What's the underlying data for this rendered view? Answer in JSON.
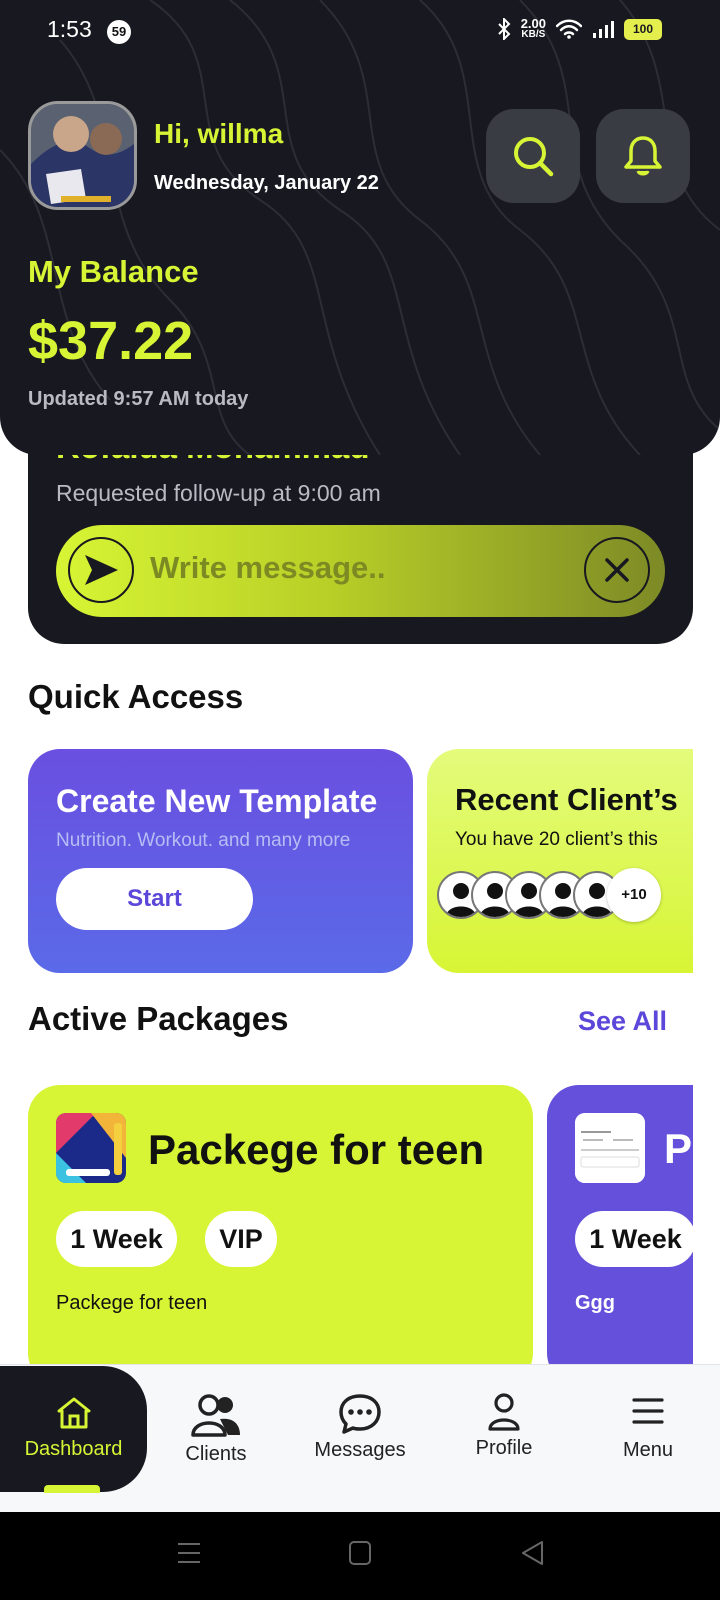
{
  "status_bar": {
    "time": "1:53",
    "notification_count": "59",
    "net_speed_value": "2.00",
    "net_speed_unit": "KB/S",
    "battery": "100"
  },
  "header": {
    "greeting": "Hi, willma",
    "date": "Wednesday, January 22",
    "balance_label": "My Balance",
    "balance_value": "$37.22",
    "updated_text": "Updated 9:57 AM today",
    "icons": [
      "search-icon",
      "bell-icon"
    ]
  },
  "message_card": {
    "client_name": "Rofaida Mohammad",
    "subtitle": "Requested follow-up at 9:00 am",
    "placeholder": "Write message..",
    "icons": [
      "send-icon",
      "close-icon"
    ]
  },
  "quick_access": {
    "title": "Quick Access",
    "create_template": {
      "title": "Create New Template",
      "subtitle": "Nutrition. Workout. and many more",
      "button": "Start"
    },
    "recent_clients": {
      "title": "Recent Client’s",
      "subtitle": "You have 20 client’s this",
      "more_count": "+10"
    }
  },
  "packages": {
    "title": "Active Packages",
    "see_all": "See All",
    "items": [
      {
        "name": "Packege for teen",
        "duration": "1 Week",
        "tier": "VIP",
        "description": "Packege for teen",
        "color": "#d7f534"
      },
      {
        "name": "P",
        "duration": "1 Week",
        "description": "Ggg",
        "color": "#6550dc"
      }
    ]
  },
  "bottom_nav": {
    "items": [
      {
        "label": "Dashboard",
        "icon": "home-icon",
        "active": true
      },
      {
        "label": "Clients",
        "icon": "users-icon",
        "active": false
      },
      {
        "label": "Messages",
        "icon": "chat-icon",
        "active": false
      },
      {
        "label": "Profile",
        "icon": "profile-icon",
        "active": false
      },
      {
        "label": "Menu",
        "icon": "menu-icon",
        "active": false
      }
    ]
  },
  "colors": {
    "accent_lime": "#d7f534",
    "dark": "#181820",
    "purple": "#5b47d9"
  }
}
